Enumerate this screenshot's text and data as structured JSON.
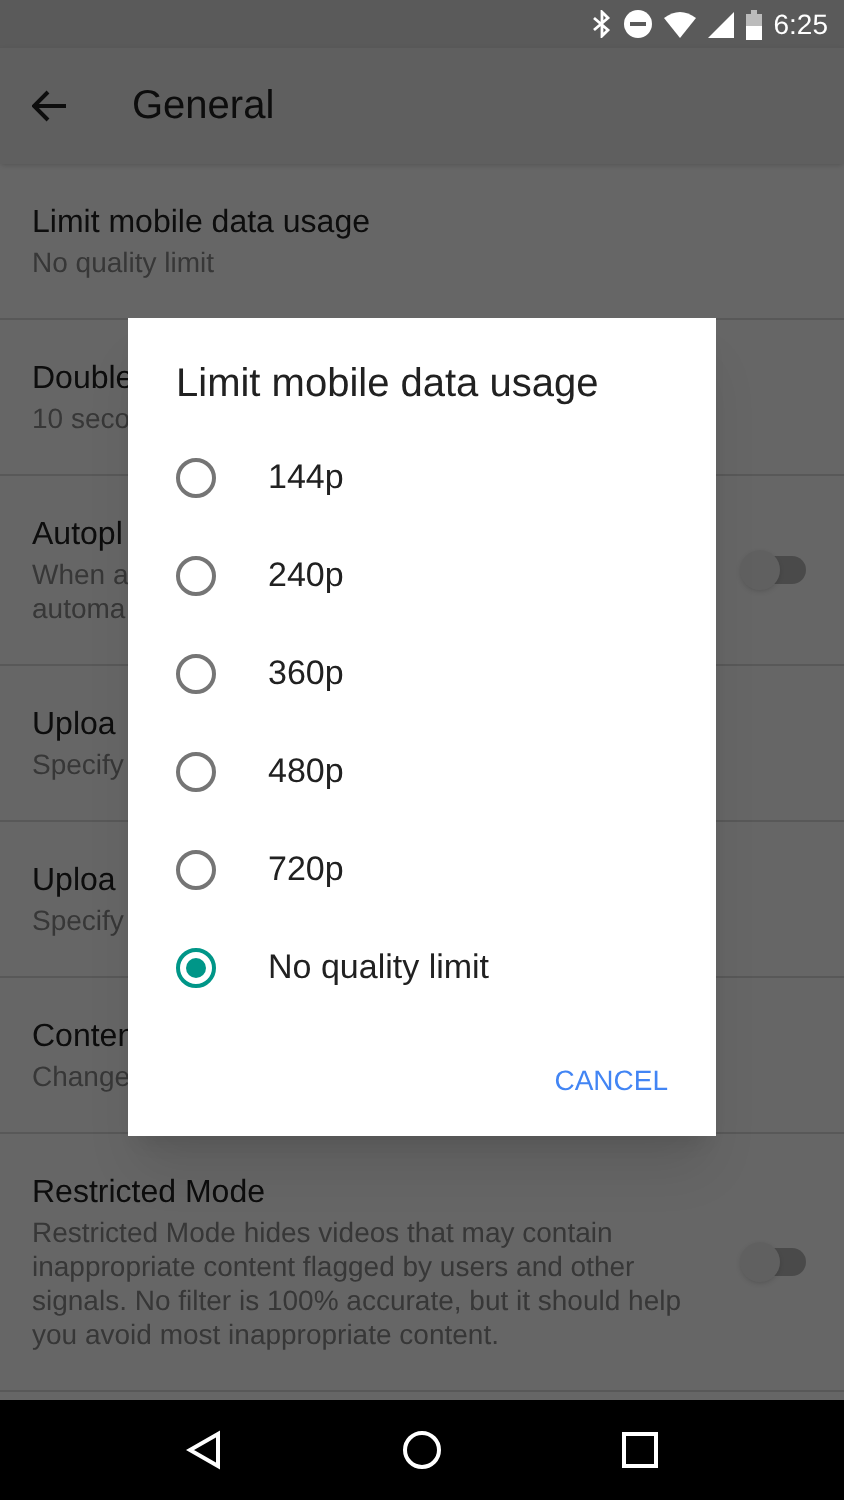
{
  "status_bar": {
    "time": "6:25"
  },
  "app_bar": {
    "title": "General"
  },
  "settings": [
    {
      "title": "Limit mobile data usage",
      "subtitle": "No quality limit",
      "kind": "plain"
    },
    {
      "title": "Double",
      "subtitle": "10 seco",
      "kind": "plain"
    },
    {
      "title": "Autopl",
      "subtitle": "When a\nautoma",
      "kind": "toggle",
      "on": false
    },
    {
      "title": "Uploa",
      "subtitle": "Specify",
      "kind": "plain"
    },
    {
      "title": "Uploa",
      "subtitle": "Specify",
      "kind": "plain"
    },
    {
      "title": "Conten",
      "subtitle": "Change",
      "kind": "plain"
    },
    {
      "title": "Restricted Mode",
      "subtitle": "Restricted Mode hides videos that may contain inappropriate content flagged by users and other signals. No filter is 100% accurate, but it should help you avoid most inappropriate content.",
      "kind": "toggle",
      "on": false
    }
  ],
  "dialog": {
    "title": "Limit mobile data usage",
    "options": [
      {
        "label": "144p",
        "selected": false
      },
      {
        "label": "240p",
        "selected": false
      },
      {
        "label": "360p",
        "selected": false
      },
      {
        "label": "480p",
        "selected": false
      },
      {
        "label": "720p",
        "selected": false
      },
      {
        "label": "No quality limit",
        "selected": true
      }
    ],
    "buttons": [
      "CANCEL"
    ]
  }
}
